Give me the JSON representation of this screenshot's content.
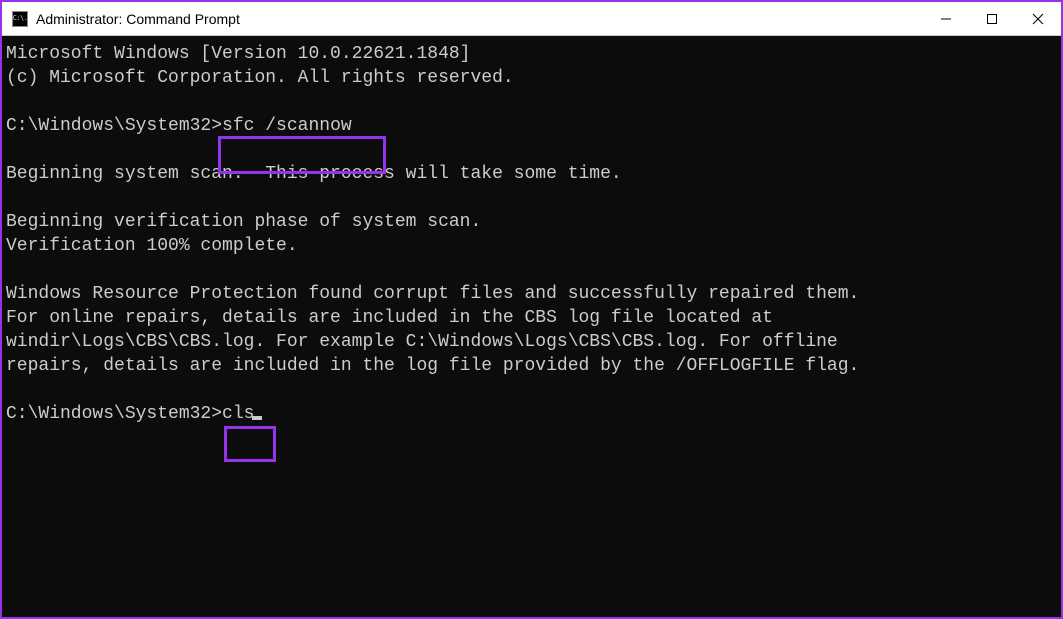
{
  "window": {
    "title": "Administrator: Command Prompt",
    "icon_label": "C:\\."
  },
  "highlight_color": "#9333ea",
  "terminal": {
    "version_line": "Microsoft Windows [Version 10.0.22621.1848]",
    "copyright_line": "(c) Microsoft Corporation. All rights reserved.",
    "prompt_path": "C:\\Windows\\System32>",
    "cmd1": "sfc /scannow",
    "blank": "",
    "begin_scan": "Beginning system scan.  This process will take some time.",
    "begin_verify": "Beginning verification phase of system scan.",
    "verify_complete": "Verification 100% complete.",
    "result1": "Windows Resource Protection found corrupt files and successfully repaired them.",
    "result2": "For online repairs, details are included in the CBS log file located at",
    "result3": "windir\\Logs\\CBS\\CBS.log. For example C:\\Windows\\Logs\\CBS\\CBS.log. For offline",
    "result4": "repairs, details are included in the log file provided by the /OFFLOGFILE flag.",
    "cmd2": "cls"
  }
}
